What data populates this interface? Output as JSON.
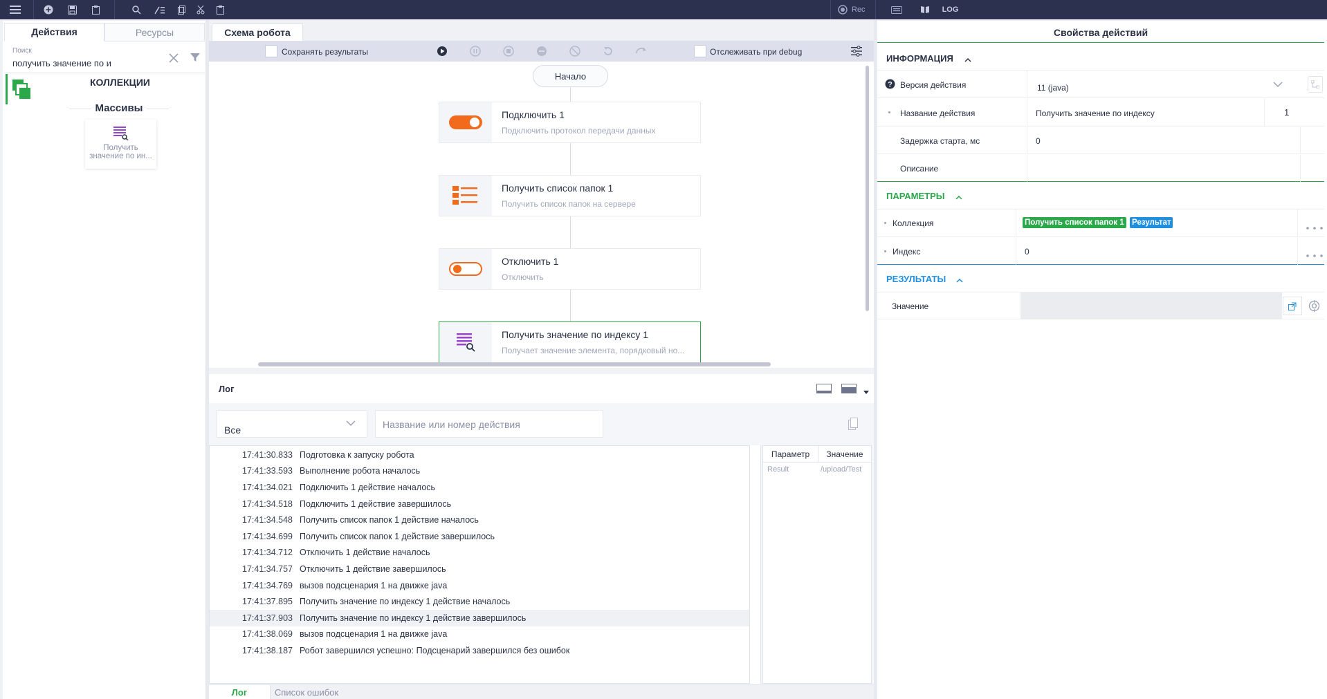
{
  "toolbar": {
    "rec_label": "Rec",
    "log_label": "LOG"
  },
  "left": {
    "tabs": [
      "Действия",
      "Ресурсы"
    ],
    "search": {
      "label": "Поиск",
      "value": "получить значение по и"
    },
    "category": "КОЛЛЕКЦИИ",
    "subcategory": "Массивы",
    "card_label_1": "Получить",
    "card_label_2": "значение по ин..."
  },
  "center": {
    "tab": "Схема робота",
    "save_results": "Сохранять результаты",
    "track_debug": "Отслеживать при debug",
    "start_label": "Начало",
    "blocks": [
      {
        "title": "Подключить  1",
        "sub": "Подключить протокол передачи данных"
      },
      {
        "title": "Получить список папок  1",
        "sub": "Получить список папок на сервере"
      },
      {
        "title": "Отключить  1",
        "sub": "Отключить"
      },
      {
        "title": "Получить значение по индексу  1",
        "sub": "Получает значение элемента, порядковый но..."
      }
    ]
  },
  "log": {
    "title": "Лог",
    "filter_value": "Все",
    "search_placeholder": "Название или номер действия",
    "lines": [
      {
        "time": "17:41:30.833",
        "msg": "Подготовка к запуску робота"
      },
      {
        "time": "17:41:33.593",
        "msg": "Выполнение робота началось"
      },
      {
        "time": "17:41:34.021",
        "msg": "Подключить 1 действие началось"
      },
      {
        "time": "17:41:34.518",
        "msg": "Подключить 1 действие завершилось"
      },
      {
        "time": "17:41:34.548",
        "msg": "Получить список папок 1 действие началось"
      },
      {
        "time": "17:41:34.699",
        "msg": "Получить список папок 1 действие завершилось"
      },
      {
        "time": "17:41:34.712",
        "msg": "Отключить 1 действие началось"
      },
      {
        "time": "17:41:34.757",
        "msg": "Отключить 1 действие завершилось"
      },
      {
        "time": "17:41:34.769",
        "msg": "вызов подсценария 1 на движке java"
      },
      {
        "time": "17:41:37.895",
        "msg": "Получить значение по индексу 1 действие началось"
      },
      {
        "time": "17:41:37.903",
        "msg": "Получить значение по индексу 1 действие завершилось"
      },
      {
        "time": "17:41:38.069",
        "msg": "вызов подсценария 1 на движке java"
      },
      {
        "time": "17:41:38.187",
        "msg": "Робот завершился успешно: Подсценарий завершился без ошибок"
      }
    ],
    "params_header": [
      "Параметр",
      "Значение"
    ],
    "params_row": [
      "Result",
      "/upload/Test"
    ],
    "bottom_tabs": [
      "Лог",
      "Список ошибок"
    ]
  },
  "right": {
    "title": "Свойства действий",
    "info_section": "ИНФОРМАЦИЯ",
    "version_label": "Версия действия",
    "version_value": "11 (java)",
    "name_label": "Название действия",
    "name_value": "Получить значение по индексу",
    "name_num": "1",
    "delay_label": "Задержка старта, мс",
    "delay_value": "0",
    "desc_label": "Описание",
    "params_section": "ПАРАМЕТРЫ",
    "collection_label": "Коллекция",
    "collection_tag1": "Получить список папок 1",
    "collection_tag2": "Результат",
    "index_label": "Индекс",
    "index_value": "0",
    "results_section": "РЕЗУЛЬТАТЫ",
    "value_label": "Значение"
  },
  "colors": {
    "accent_green": "#2aa84a",
    "accent_orange": "#f26b1d",
    "accent_blue": "#1f8fe0",
    "topbar": "#2c3150"
  }
}
